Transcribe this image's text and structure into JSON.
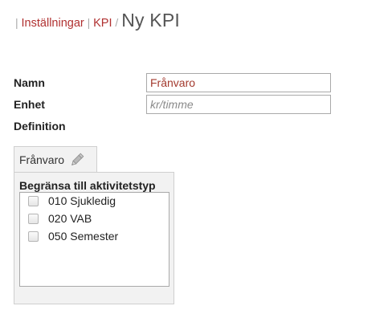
{
  "breadcrumb": {
    "leading_separator": "|",
    "items": [
      {
        "label": "Inställningar"
      },
      {
        "label": "KPI"
      }
    ],
    "separator_1": "|",
    "separator_2": "/",
    "current": "Ny KPI"
  },
  "form": {
    "name_label": "Namn",
    "name_value": "Frånvaro",
    "unit_label": "Enhet",
    "unit_value": "",
    "unit_placeholder": "kr/timme",
    "definition_label": "Definition"
  },
  "definition_tab": {
    "label": "Frånvaro",
    "icon": "pencil-icon"
  },
  "activity_filter": {
    "title": "Begränsa till aktivitetstyp",
    "items": [
      {
        "label": "010 Sjukledig",
        "checked": false
      },
      {
        "label": "020 VAB",
        "checked": false
      },
      {
        "label": "050 Semester",
        "checked": false
      }
    ]
  },
  "colors": {
    "link": "#b03030",
    "name_value_text": "#a33a2e",
    "panel_bg": "#f2f2f2",
    "border": "#a9a9a9"
  }
}
